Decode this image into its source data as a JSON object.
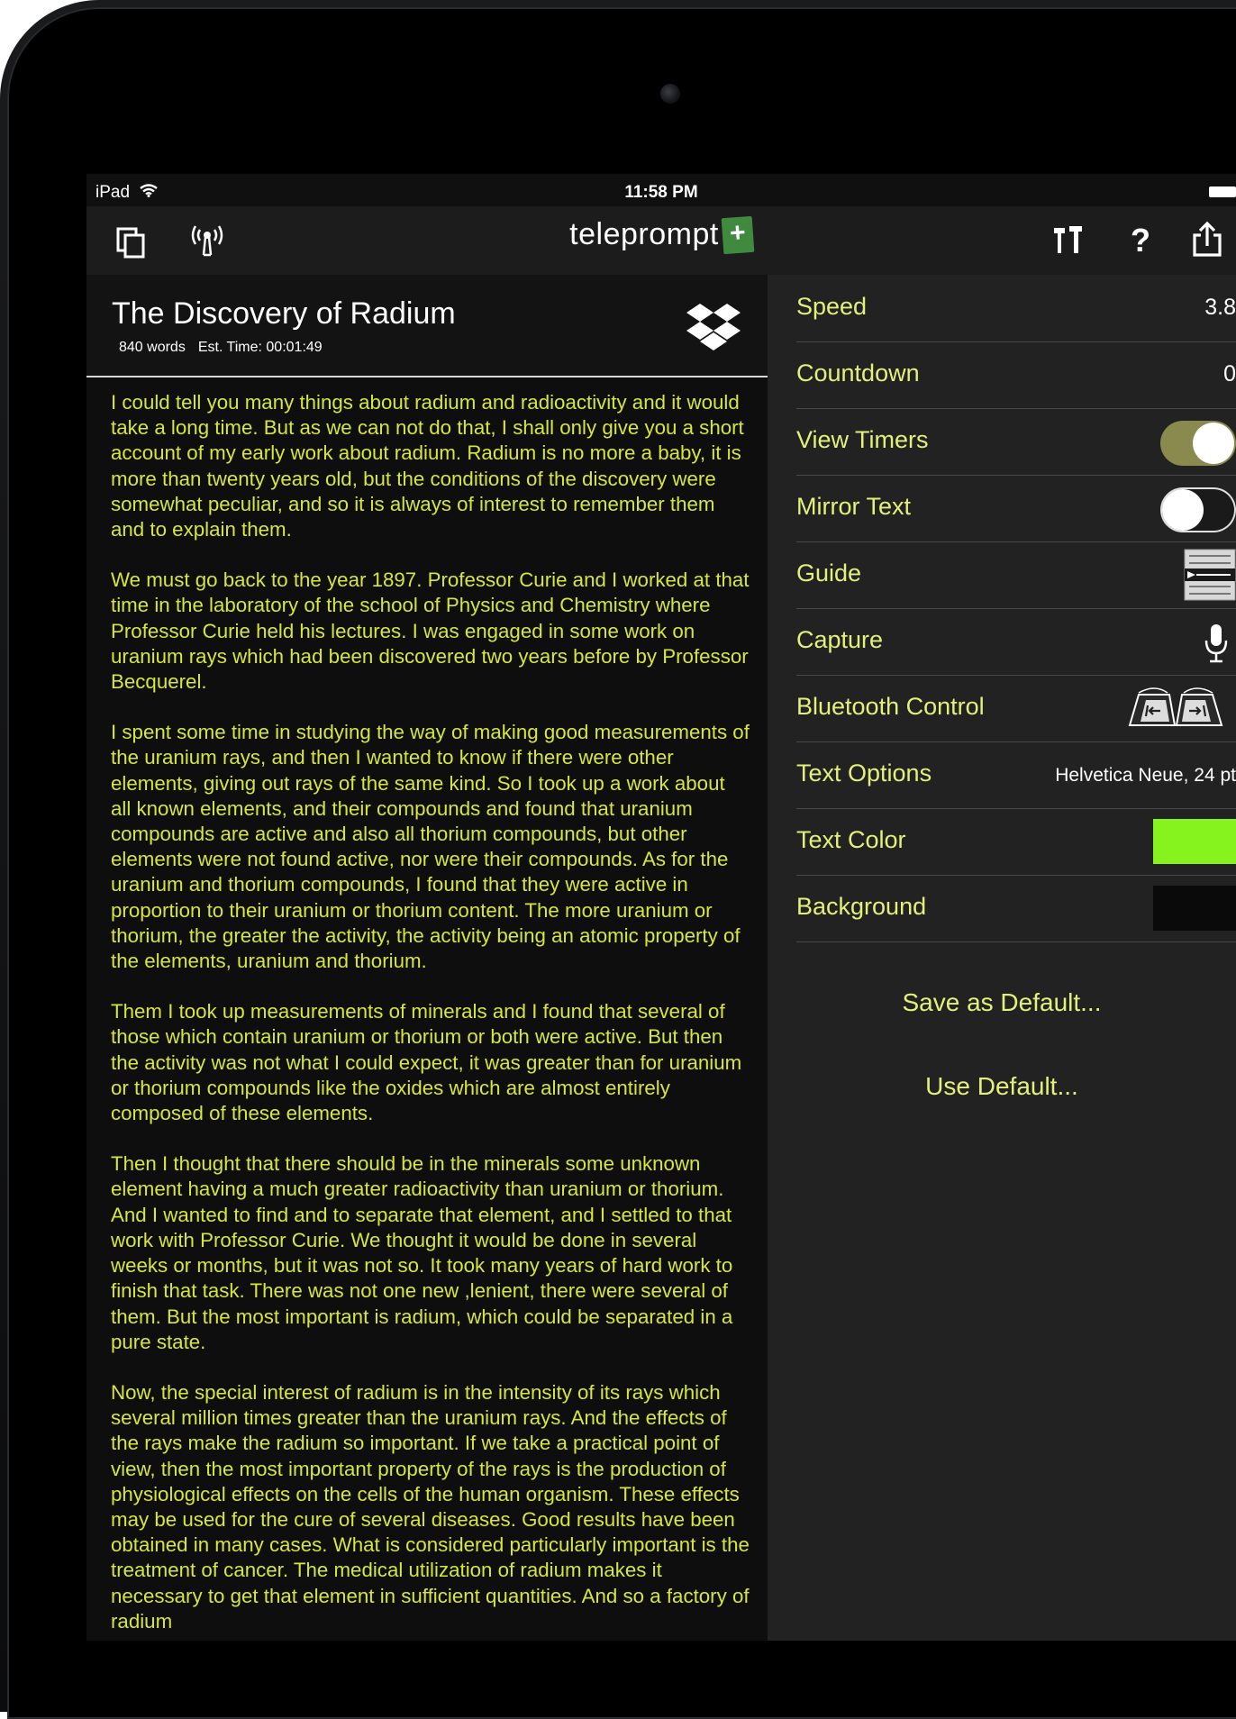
{
  "status_bar": {
    "carrier": "iPad",
    "time": "11:58 PM"
  },
  "nav": {
    "logo_text": "teleprompt",
    "logo_plus": "+"
  },
  "document": {
    "title": "The Discovery of Radium",
    "word_count": "840 words",
    "est_time": "Est. Time: 00:01:49",
    "paragraphs": [
      "I could tell you many things about radium and radioactivity and it would take a long time. But as we can not do that, I shall only give you a short account of my early work about radium. Radium is no more a baby, it is more than twenty years old, but the conditions of the discovery were somewhat peculiar, and so it is always of interest to remember them and to explain them.",
      "We must go back to the year 1897. Professor Curie and I worked at that time in the laboratory of the school of Physics and Chemistry where Professor Curie held his lectures. I was engaged in some work on uranium rays which had been discovered two years before by Professor Becquerel.",
      "I spent some time in studying the way of making good measurements of the uranium rays, and then I wanted to know if there were other elements, giving out rays of the same kind. So I took up a work about all known elements, and their compounds and found that uranium compounds are active and also all thorium compounds, but other elements were not found active, nor were their compounds. As for the uranium and thorium compounds, I found that they were active in proportion to their uranium or thorium content. The more uranium or thorium, the greater the activity, the activity being an atomic property of the elements, uranium and thorium.",
      "Them I took up measurements of minerals and I found that several of those which contain uranium or thorium or both were active. But then the activity was not what I could expect, it was greater than for uranium or thorium compounds like the oxides which are almost entirely composed of these elements.",
      "Then I thought that there should be in the minerals some unknown element having a much greater radioactivity than uranium or thorium. And I wanted to find and to separate that element, and I settled to that work with Professor Curie. We thought it would be done in several weeks or months, but it was not so. It took many years of hard work to finish that task. There was not one new ,lenient, there were several of them. But the most important is radium, which could be separated in a pure state.",
      "Now, the special interest of radium is in the intensity of its rays which several million times greater than the uranium rays. And the effects of the rays make the radium so important. If we take a practical point of view, then the most important property of the rays is the production of physiological effects on the cells of the human organism. These effects may be used for the cure of several diseases. Good results have been obtained in many cases. What is considered particularly important is the treatment of cancer. The medical utilization of radium makes it necessary to get that element in sufficient quantities. And so a factory of radium"
    ]
  },
  "settings": {
    "speed": {
      "label": "Speed",
      "value": "3.8"
    },
    "countdown": {
      "label": "Countdown",
      "value": "0"
    },
    "view_timers": {
      "label": "View Timers",
      "on": true
    },
    "mirror_text": {
      "label": "Mirror Text",
      "on": false
    },
    "guide": {
      "label": "Guide"
    },
    "capture": {
      "label": "Capture"
    },
    "bluetooth": {
      "label": "Bluetooth Control"
    },
    "text_options": {
      "label": "Text Options",
      "value": "Helvetica Neue, 24 pt"
    },
    "text_color": {
      "label": "Text Color",
      "color": "#86f21e"
    },
    "background": {
      "label": "Background",
      "color": "#0a0a0a"
    }
  },
  "actions": {
    "save_default": "Save as Default...",
    "use_default": "Use Default..."
  },
  "colors": {
    "script_text": "#d7e63a",
    "settings_label": "#e3f07a",
    "pane_bg": "#222223"
  }
}
